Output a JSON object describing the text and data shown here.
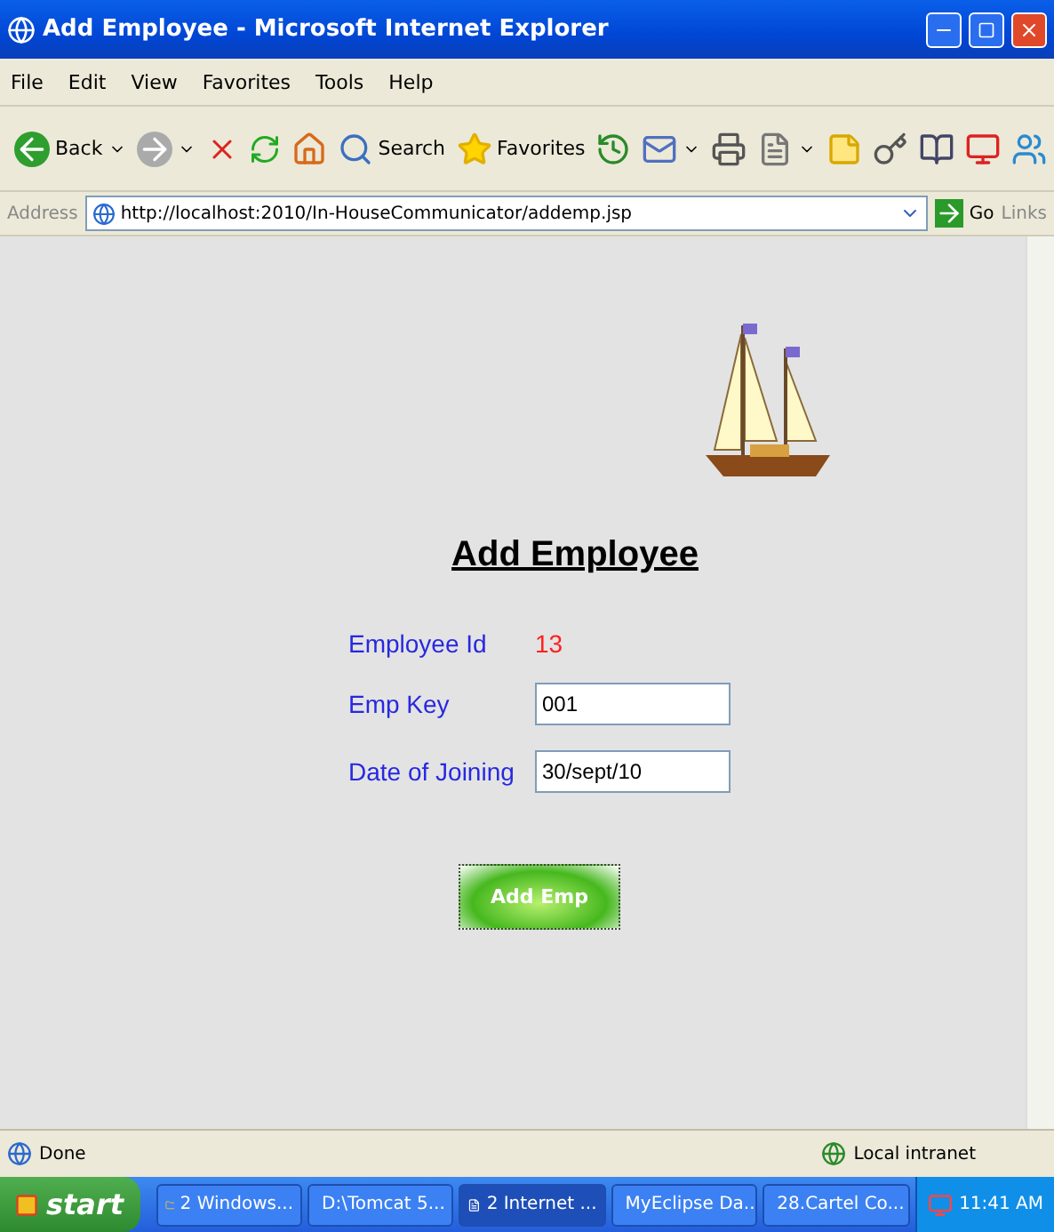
{
  "window": {
    "title": "Add Employee - Microsoft Internet Explorer"
  },
  "menu": [
    "File",
    "Edit",
    "View",
    "Favorites",
    "Tools",
    "Help"
  ],
  "toolbar": [
    {
      "label": "Back",
      "dropdown": true
    },
    {
      "dropdown": true
    },
    {
      "dropdown": false
    },
    {
      "dropdown": false
    },
    {
      "dropdown": false
    },
    {
      "label": "Search",
      "dropdown": false
    },
    {
      "label": "Favorites",
      "dropdown": false
    },
    {
      "dropdown": false
    },
    {
      "dropdown": true
    },
    {
      "dropdown": false
    },
    {
      "dropdown": true
    },
    {
      "dropdown": false
    },
    {
      "dropdown": false
    },
    {
      "dropdown": false
    },
    {
      "dropdown": false
    },
    {
      "dropdown": false
    }
  ],
  "address": {
    "label": "Address",
    "url": "http://localhost:2010/In-HouseCommunicator/addemp.jsp",
    "go": "Go",
    "links": "Links"
  },
  "page": {
    "heading": "Add Employee",
    "fields": [
      {
        "kind": "value",
        "label": "Employee Id",
        "value": "13"
      },
      {
        "kind": "input",
        "label": "Emp Key",
        "value": "001"
      },
      {
        "kind": "input",
        "label": "Date of Joining",
        "value": "30/sept/10"
      }
    ],
    "button": "Add Emp"
  },
  "status_bar": {
    "text": "Done",
    "zone": "Local intranet"
  },
  "taskbar": {
    "start": "start",
    "items": [
      {
        "label": "2 Windows...",
        "selected": false
      },
      {
        "label": "D:\\Tomcat 5...",
        "selected": false
      },
      {
        "label": "2 Internet ...",
        "selected": true
      },
      {
        "label": "MyEclipse Da...",
        "selected": false
      },
      {
        "label": "28.Cartel Co...",
        "selected": false
      }
    ],
    "clock": "11:41 AM"
  }
}
